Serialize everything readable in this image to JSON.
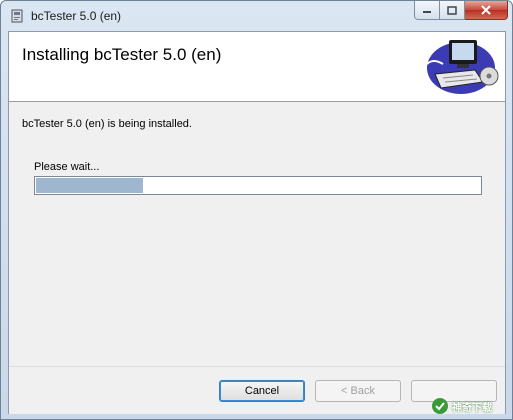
{
  "window": {
    "title": "bcTester 5.0 (en)"
  },
  "banner": {
    "title": "Installing bcTester 5.0 (en)",
    "graphic_icon": "computer-installer-icon"
  },
  "status": {
    "message": "bcTester 5.0 (en) is being installed.",
    "wait_label": "Please wait...",
    "progress_fraction": 0.24
  },
  "buttons": {
    "cancel_label": "Cancel",
    "back_label": "< Back",
    "next_label": ""
  },
  "watermark": {
    "text": "神奇下载"
  },
  "colors": {
    "progress_fill": "#9fb6cf",
    "close_button": "#c9463a"
  }
}
